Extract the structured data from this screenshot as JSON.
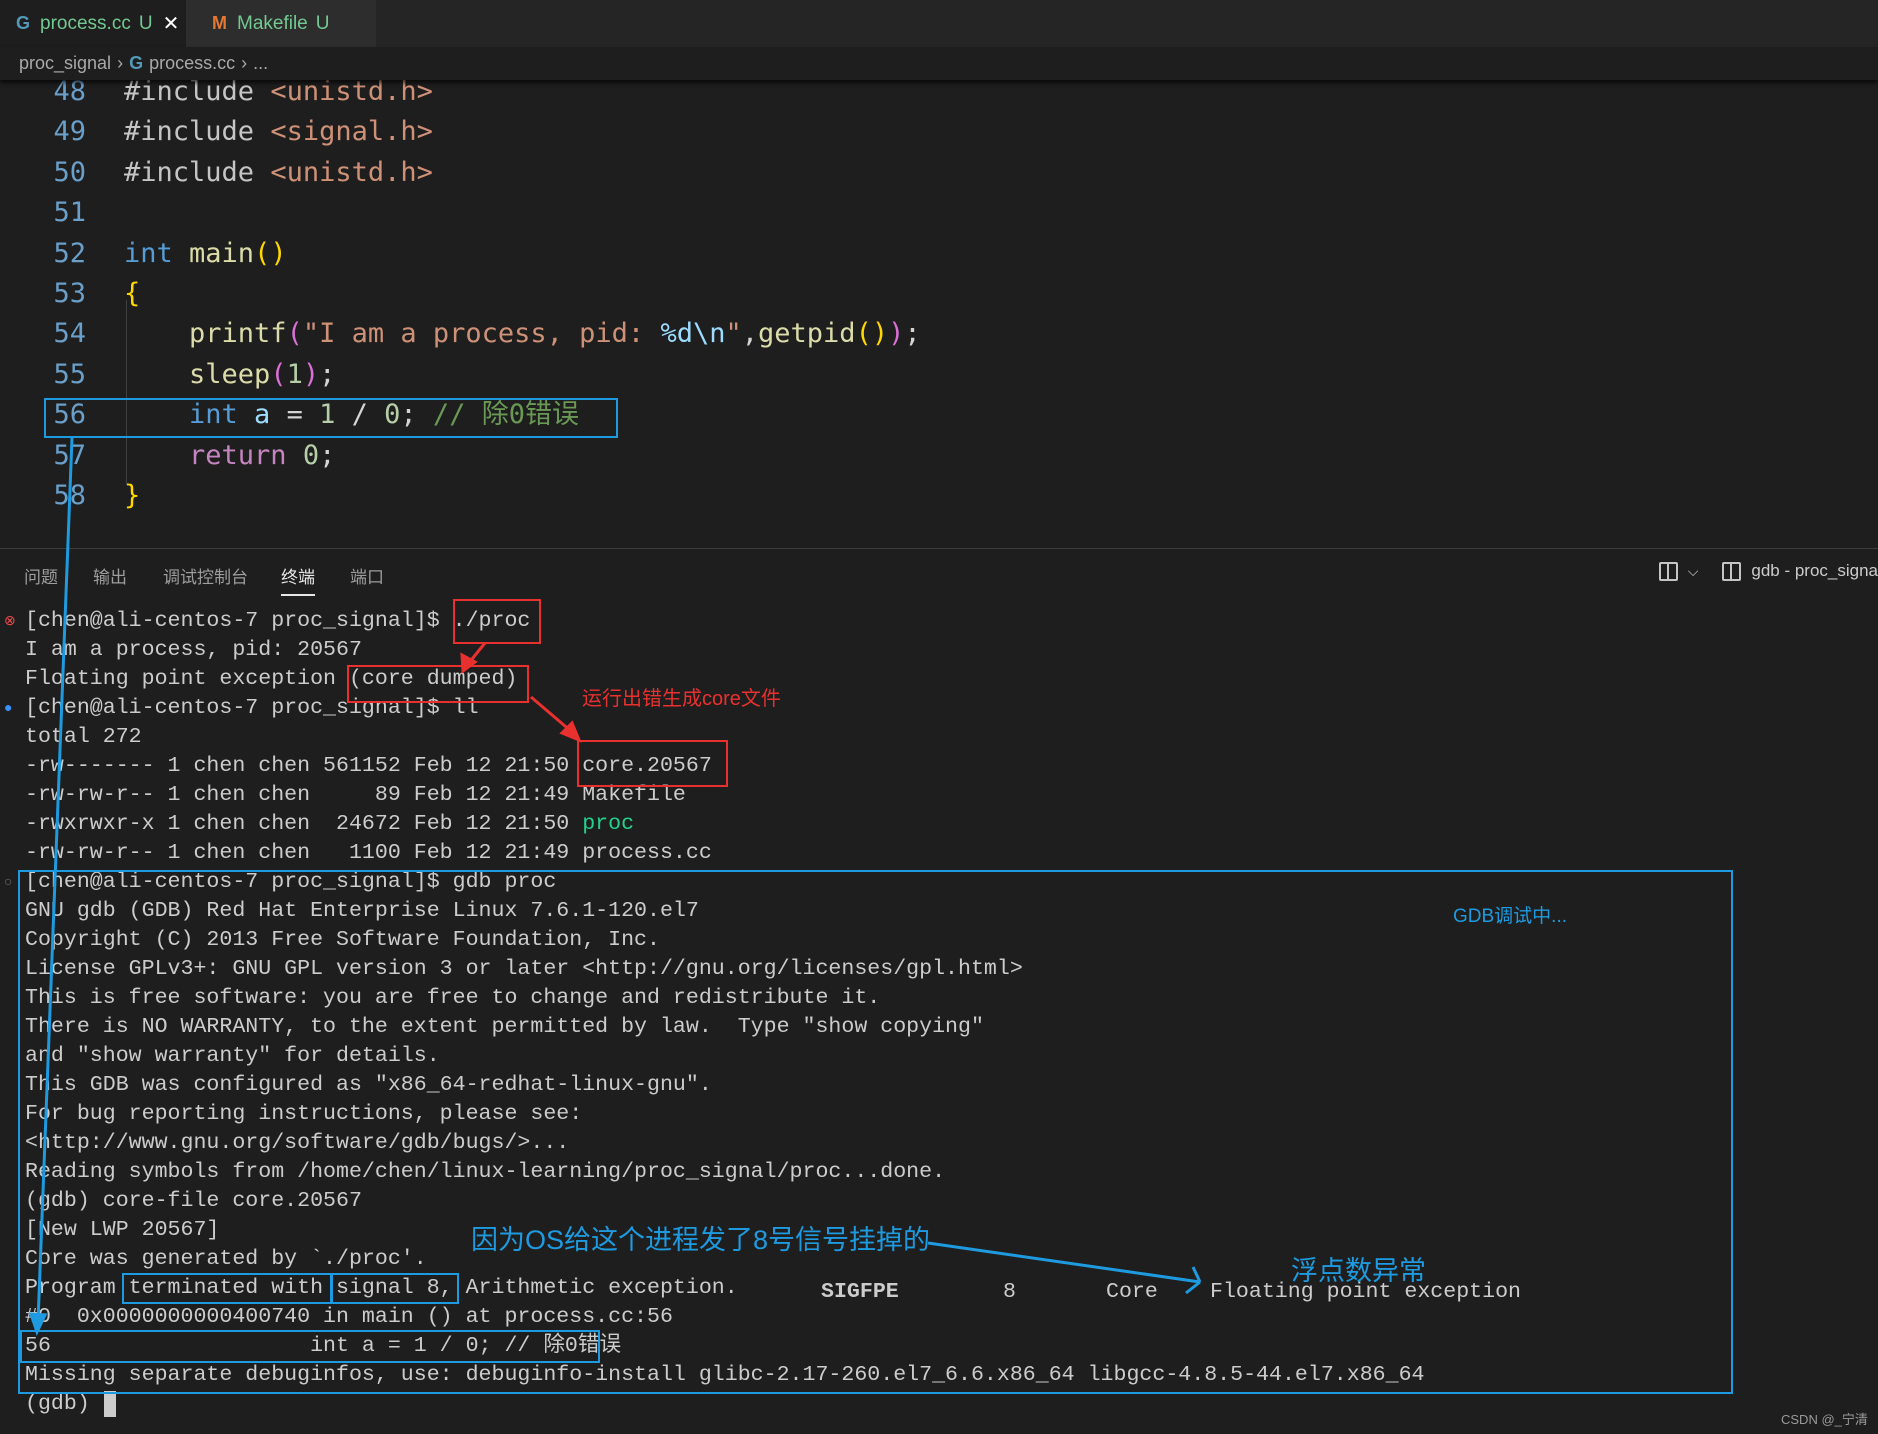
{
  "tabs": [
    {
      "icon": "G",
      "label": "process.cc",
      "status": "U",
      "close": "✕"
    },
    {
      "icon": "M",
      "label": "Makefile",
      "status": "U"
    }
  ],
  "breadcrumb": {
    "folder": "proc_signal",
    "file": "process.cc",
    "more": "..."
  },
  "code": [
    {
      "n": "48",
      "tokens": [
        [
          "#include ",
          "pre"
        ],
        [
          "<unistd.h>",
          "str"
        ]
      ]
    },
    {
      "n": "49",
      "tokens": [
        [
          "#include ",
          "pre"
        ],
        [
          "<signal.h>",
          "str"
        ]
      ]
    },
    {
      "n": "50",
      "tokens": [
        [
          "#include ",
          "pre"
        ],
        [
          "<unistd.h>",
          "str"
        ]
      ]
    },
    {
      "n": "51",
      "tokens": []
    },
    {
      "n": "52",
      "tokens": [
        [
          "int ",
          "kw"
        ],
        [
          "main",
          "fn"
        ],
        [
          "()",
          "b1"
        ]
      ]
    },
    {
      "n": "53",
      "tokens": [
        [
          "{",
          "b1"
        ]
      ]
    },
    {
      "n": "54",
      "tokens": [
        [
          "    printf",
          "fn"
        ],
        [
          "(",
          "b2"
        ],
        [
          "\"I am a process, pid: ",
          "str"
        ],
        [
          "%d\\n",
          "esc"
        ],
        [
          "\"",
          "str"
        ],
        [
          ",",
          "p"
        ],
        [
          "getpid",
          "fn"
        ],
        [
          "()",
          "b1"
        ],
        [
          ")",
          "b2"
        ],
        [
          ";",
          "p"
        ]
      ]
    },
    {
      "n": "55",
      "tokens": [
        [
          "    sleep",
          "fn"
        ],
        [
          "(",
          "b2"
        ],
        [
          "1",
          "num"
        ],
        [
          ")",
          "b2"
        ],
        [
          ";",
          "p"
        ]
      ]
    },
    {
      "n": "56",
      "tokens": [
        [
          "    int ",
          "kw"
        ],
        [
          "a",
          "var"
        ],
        [
          " = ",
          "p"
        ],
        [
          "1",
          "num"
        ],
        [
          " / ",
          "p"
        ],
        [
          "0",
          "num"
        ],
        [
          "; ",
          "p"
        ],
        [
          "// 除0错误",
          "com"
        ]
      ]
    },
    {
      "n": "57",
      "tokens": [
        [
          "    return ",
          "ctl"
        ],
        [
          "0",
          "num"
        ],
        [
          ";",
          "p"
        ]
      ]
    },
    {
      "n": "58",
      "tokens": [
        [
          "}",
          "b1"
        ]
      ]
    }
  ],
  "panel": {
    "tabs": [
      "问题",
      "输出",
      "调试控制台",
      "终端",
      "端口"
    ],
    "active_tab": "终端",
    "terminal_name": "gdb - proc_signa"
  },
  "terminal": [
    [
      {
        "t": "[chen@ali-centos-7 proc_signal]$ ./proc"
      }
    ],
    [
      {
        "t": "I am a process, pid: 20567"
      }
    ],
    [
      {
        "t": "Floating point exception (core dumped)"
      }
    ],
    [
      {
        "t": "[chen@ali-centos-7 proc_signal]$ ll"
      }
    ],
    [
      {
        "t": "total 272"
      }
    ],
    [
      {
        "t": "-rw------- 1 chen chen 561152 Feb 12 21:50 core.20567"
      }
    ],
    [
      {
        "t": "-rw-rw-r-- 1 chen chen     89 Feb 12 21:49 Makefile"
      }
    ],
    [
      {
        "t": "-rwxrwxr-x 1 chen chen  24672 Feb 12 21:50 "
      },
      {
        "t": "proc",
        "c": "g"
      }
    ],
    [
      {
        "t": "-rw-rw-r-- 1 chen chen   1100 Feb 12 21:49 process.cc"
      }
    ],
    [
      {
        "t": "[chen@ali-centos-7 proc_signal]$ gdb proc"
      }
    ],
    [
      {
        "t": "GNU gdb (GDB) Red Hat Enterprise Linux 7.6.1-120.el7"
      }
    ],
    [
      {
        "t": "Copyright (C) 2013 Free Software Foundation, Inc."
      }
    ],
    [
      {
        "t": "License GPLv3+: GNU GPL version 3 or later <http://gnu.org/licenses/gpl.html>"
      }
    ],
    [
      {
        "t": "This is free software: you are free to change and redistribute it."
      }
    ],
    [
      {
        "t": "There is NO WARRANTY, to the extent permitted by law.  Type \"show copying\""
      }
    ],
    [
      {
        "t": "and \"show warranty\" for details."
      }
    ],
    [
      {
        "t": "This GDB was configured as \"x86_64-redhat-linux-gnu\"."
      }
    ],
    [
      {
        "t": "For bug reporting instructions, please see:"
      }
    ],
    [
      {
        "t": "<http://www.gnu.org/software/gdb/bugs/>..."
      }
    ],
    [
      {
        "t": "Reading symbols from /home/chen/linux-learning/proc_signal/proc...done."
      }
    ],
    [
      {
        "t": "(gdb) core-file core.20567"
      }
    ],
    [
      {
        "t": "[New LWP 20567]"
      }
    ],
    [
      {
        "t": "Core was generated by `./proc'."
      }
    ],
    [
      {
        "t": "Program terminated with signal 8, Arithmetic exception."
      }
    ],
    [
      {
        "t": "#0  0x0000000000400740 in main () at process.cc:56"
      }
    ],
    [
      {
        "t": "56\t            int a = 1 / 0; // 除0错误"
      }
    ],
    [
      {
        "t": "Missing separate debuginfos, use: debuginfo-install glibc-2.17-260.el7_6.6.x86_64 libgcc-4.8.5-44.el7.x86_64"
      }
    ],
    [
      {
        "t": "(gdb) "
      }
    ]
  ],
  "signal_table": {
    "name": "SIGFPE",
    "number": "8",
    "action": "Core",
    "description": "Floating point exception"
  },
  "annotations": {
    "core_file": "运行出错生成core文件",
    "gdb_debugging": "GDB调试中...",
    "reason": "因为OS给这个进程发了8号信号挂掉的",
    "fpe": "浮点数异常",
    "red": "#e8312f",
    "blue": "#1e9be0"
  },
  "watermark": "CSDN @_宁清"
}
